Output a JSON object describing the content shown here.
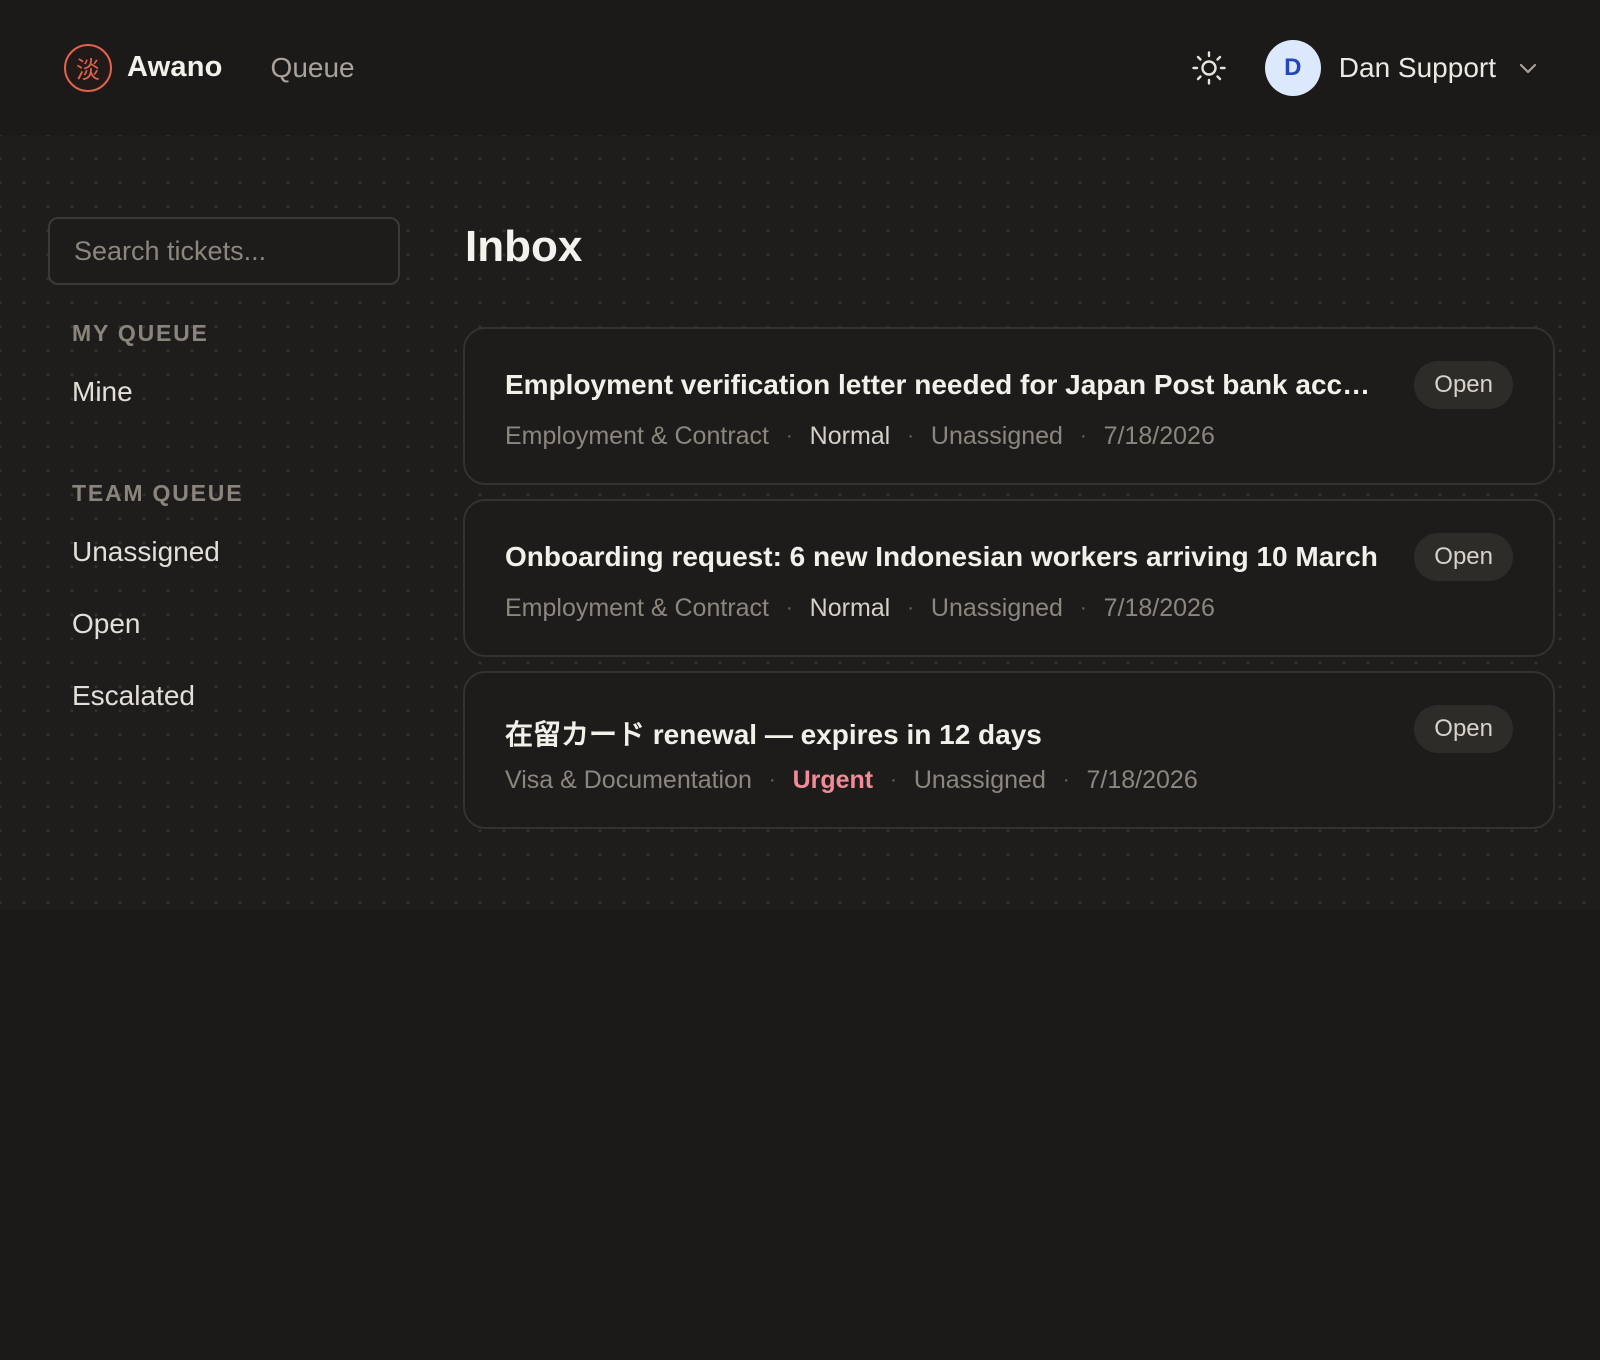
{
  "header": {
    "logo_glyph": "淡",
    "brand": "Awano",
    "nav_queue": "Queue",
    "theme_icon": "sun-icon",
    "user": {
      "initial": "D",
      "name": "Dan Support"
    }
  },
  "sidebar": {
    "search_placeholder": "Search tickets...",
    "my_queue_label": "MY QUEUE",
    "my_queue_items": [
      "Mine"
    ],
    "team_queue_label": "TEAM QUEUE",
    "team_queue_items": [
      "Unassigned",
      "Open",
      "Escalated"
    ]
  },
  "main": {
    "title": "Inbox",
    "tickets": [
      {
        "title": "Employment verification letter needed for Japan Post bank account",
        "status": "Open",
        "category": "Employment & Contract",
        "priority": "Normal",
        "assignee": "Unassigned",
        "date": "7/18/2026"
      },
      {
        "title": "Onboarding request: 6 new Indonesian workers arriving 10 March",
        "status": "Open",
        "category": "Employment & Contract",
        "priority": "Normal",
        "assignee": "Unassigned",
        "date": "7/18/2026"
      },
      {
        "title": "在留カード renewal — expires in 12 days",
        "status": "Open",
        "category": "Visa & Documentation",
        "priority": "Urgent",
        "assignee": "Unassigned",
        "date": "7/18/2026"
      }
    ]
  },
  "colors": {
    "background": "#1b1a19",
    "accent_logo": "#e0614c",
    "urgent": "#f08b97",
    "avatar_bg": "#dce8fb",
    "avatar_text": "#2346b8"
  }
}
